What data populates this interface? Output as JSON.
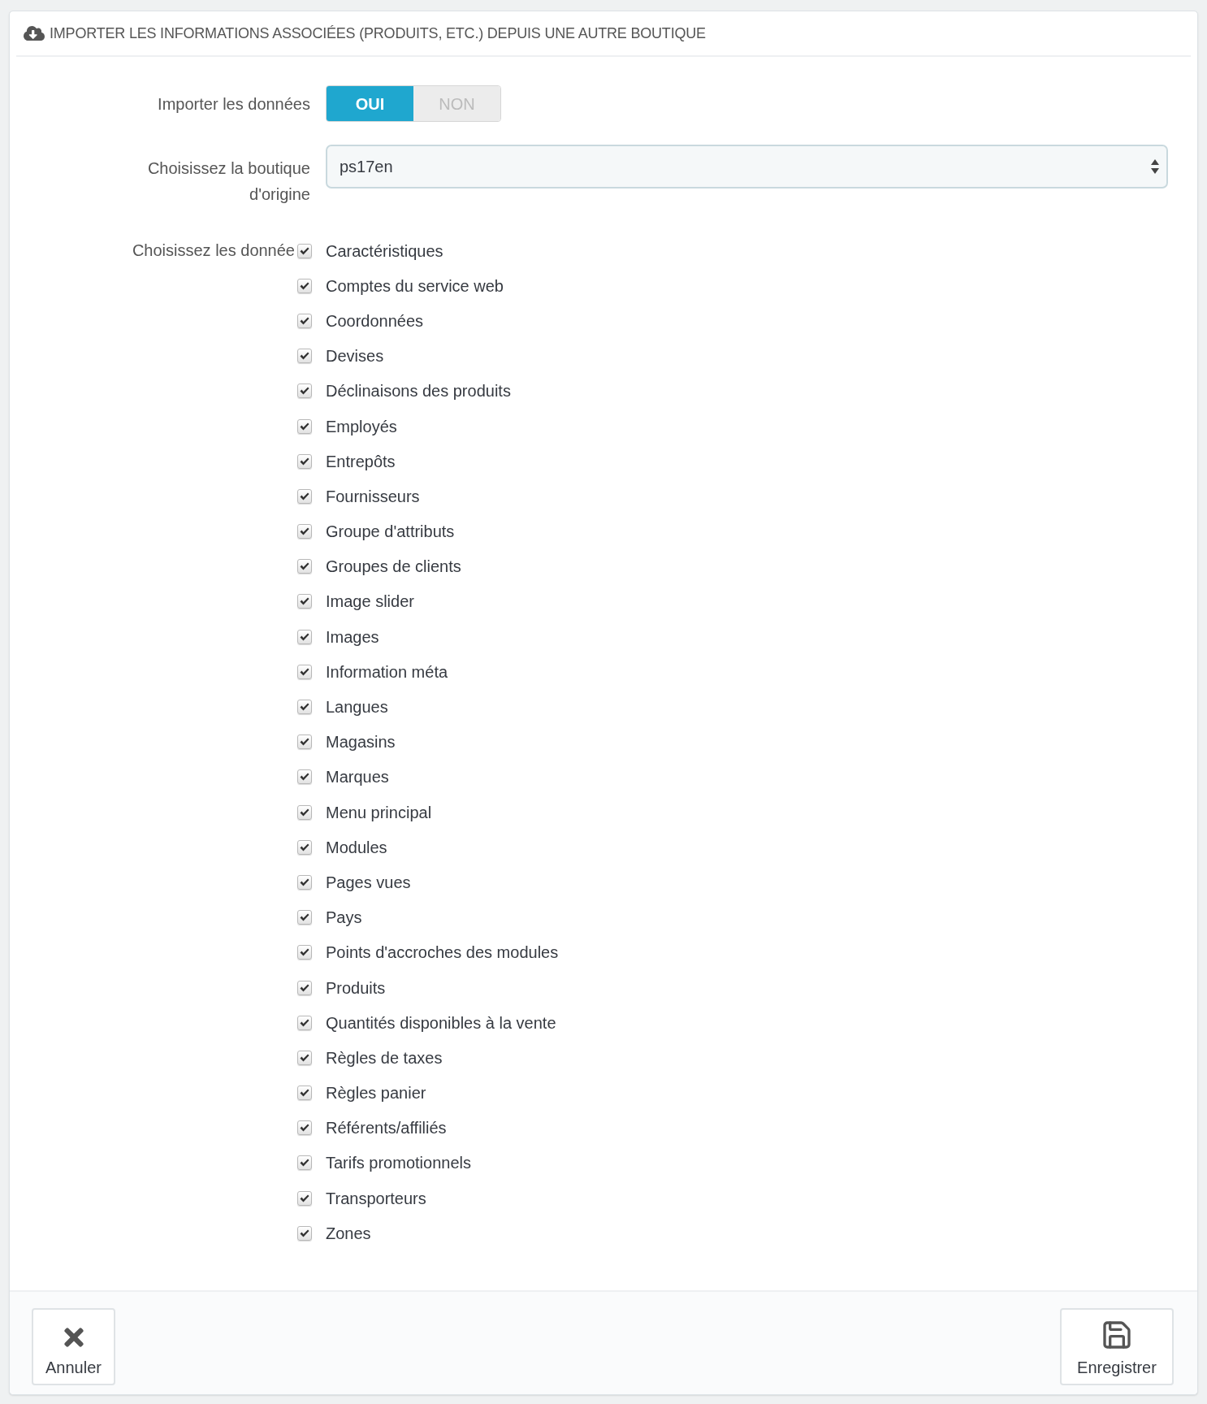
{
  "panel": {
    "title": "IMPORTER LES INFORMATIONS ASSOCIÉES (PRODUITS, ETC.) DEPUIS UNE AUTRE BOUTIQUE"
  },
  "import_data": {
    "label": "Importer les données",
    "options": [
      {
        "label": "OUI",
        "selected": true
      },
      {
        "label": "NON",
        "selected": false
      }
    ]
  },
  "source_shop": {
    "label": "Choisissez la boutique d'origine",
    "value": "ps17en"
  },
  "data_choice": {
    "label": "Choisissez les donnée",
    "items": [
      {
        "label": "Caractéristiques",
        "checked": true
      },
      {
        "label": "Comptes du service web",
        "checked": true
      },
      {
        "label": "Coordonnées",
        "checked": true
      },
      {
        "label": "Devises",
        "checked": true
      },
      {
        "label": "Déclinaisons des produits",
        "checked": true
      },
      {
        "label": "Employés",
        "checked": true
      },
      {
        "label": "Entrepôts",
        "checked": true
      },
      {
        "label": "Fournisseurs",
        "checked": true
      },
      {
        "label": "Groupe d'attributs",
        "checked": true
      },
      {
        "label": "Groupes de clients",
        "checked": true
      },
      {
        "label": "Image slider",
        "checked": true
      },
      {
        "label": "Images",
        "checked": true
      },
      {
        "label": "Information méta",
        "checked": true
      },
      {
        "label": "Langues",
        "checked": true
      },
      {
        "label": "Magasins",
        "checked": true
      },
      {
        "label": "Marques",
        "checked": true
      },
      {
        "label": "Menu principal",
        "checked": true
      },
      {
        "label": "Modules",
        "checked": true
      },
      {
        "label": "Pages vues",
        "checked": true
      },
      {
        "label": "Pays",
        "checked": true
      },
      {
        "label": "Points d'accroches des modules",
        "checked": true
      },
      {
        "label": "Produits",
        "checked": true
      },
      {
        "label": "Quantités disponibles à la vente",
        "checked": true
      },
      {
        "label": "Règles de taxes",
        "checked": true
      },
      {
        "label": "Règles panier",
        "checked": true
      },
      {
        "label": "Référents/affiliés",
        "checked": true
      },
      {
        "label": "Tarifs promotionnels",
        "checked": true
      },
      {
        "label": "Transporteurs",
        "checked": true
      },
      {
        "label": "Zones",
        "checked": true
      }
    ]
  },
  "footer": {
    "buttons": [
      {
        "label": "Annuler",
        "kind": "cancel"
      },
      {
        "label": "Enregistrer",
        "kind": "save"
      }
    ]
  }
}
